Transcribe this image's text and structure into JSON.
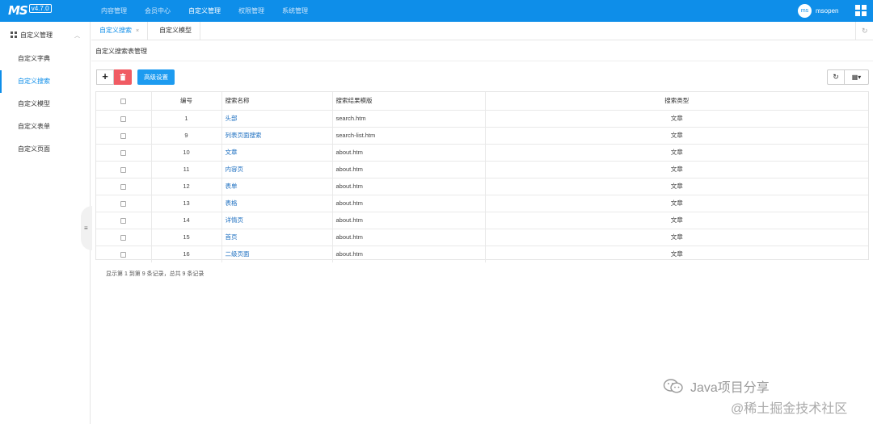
{
  "topbar": {
    "logo": "MS",
    "version": "v4.7.0",
    "nav": [
      "内容管理",
      "会员中心",
      "自定义管理",
      "权限管理",
      "系统管理"
    ],
    "active_nav": 2,
    "avatar_text": "ms",
    "username": "msopen"
  },
  "sidebar": {
    "header": "自定义管理",
    "items": [
      {
        "label": "自定义字典"
      },
      {
        "label": "自定义搜索"
      },
      {
        "label": "自定义模型"
      },
      {
        "label": "自定义表单"
      },
      {
        "label": "自定义页面"
      }
    ],
    "active_index": 1,
    "collapse_icon": "menu-icon"
  },
  "tabs": {
    "items": [
      {
        "label": "自定义搜索",
        "close": "×"
      },
      {
        "label": "自定义模型"
      }
    ],
    "refresh_glyph": "↻"
  },
  "page": {
    "title": "自定义搜索表管理",
    "toolbar": {
      "add_label": "+",
      "delete_icon": "trash-icon",
      "advanced_label": "高级设置",
      "refresh_icon": "refresh-icon",
      "columns_icon": "columns-icon"
    }
  },
  "table": {
    "headers": [
      "",
      "编号",
      "搜索名称",
      "搜索结果模版",
      "搜索类型"
    ],
    "rows": [
      {
        "id": "1",
        "name": "头部",
        "template": "search.htm",
        "type": "文章"
      },
      {
        "id": "9",
        "name": "列表页面搜索",
        "template": "search-list.htm",
        "type": "文章"
      },
      {
        "id": "10",
        "name": "文章",
        "template": "about.htm",
        "type": "文章"
      },
      {
        "id": "11",
        "name": "内容页",
        "template": "about.htm",
        "type": "文章"
      },
      {
        "id": "12",
        "name": "表单",
        "template": "about.htm",
        "type": "文章"
      },
      {
        "id": "13",
        "name": "表格",
        "template": "about.htm",
        "type": "文章"
      },
      {
        "id": "14",
        "name": "详情页",
        "template": "about.htm",
        "type": "文章"
      },
      {
        "id": "15",
        "name": "首页",
        "template": "about.htm",
        "type": "文章"
      },
      {
        "id": "16",
        "name": "二级页面",
        "template": "about.htm",
        "type": "文章"
      }
    ]
  },
  "pager": {
    "text": "显示第 1 到第 9 条记录，总共 9 条记录"
  },
  "watermark": {
    "line1": "Java项目分享",
    "line2": "@稀土掘金技术社区"
  },
  "colors": {
    "primary": "#0e8ee9",
    "danger": "#f05b63",
    "button_blue": "#1d9bf0"
  }
}
